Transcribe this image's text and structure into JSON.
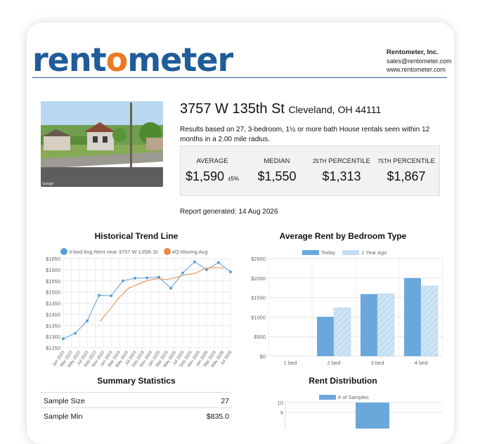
{
  "brand": {
    "logo_pre": "rent",
    "logo_o": "o",
    "logo_post": "meter"
  },
  "company": {
    "name": "Rentometer, Inc.",
    "email": "sales@rentometer.com",
    "website": "www.rentometer.com"
  },
  "property": {
    "street": "3757 W 135th St",
    "city": "Cleveland, OH 44111",
    "description": "Results based on 27, 3-bedroom, 1½ or more bath House rentals seen within 12 months in a 2.00 mile radius."
  },
  "stats": {
    "average_label": "AVERAGE",
    "average_value": "$1,590",
    "average_margin": "±5%",
    "median_label": "MEDIAN",
    "median_value": "$1,550",
    "p25_ord": "25TH",
    "p25_label": "PERCENTILE",
    "p25_value": "$1,313",
    "p75_ord": "75TH",
    "p75_label": "PERCENTILE",
    "p75_value": "$1,867"
  },
  "report_generated": "Report generated: 14 Aug 2026",
  "colors": {
    "primary": "#1f5c98",
    "accent": "#ea7a25",
    "series_blue": "#5aa0d6",
    "series_light": "#b7d6ef"
  },
  "chart_data": [
    {
      "type": "line",
      "title": "Historical Trend Line",
      "x": [
        "Jan 2023",
        "Mar 2023",
        "May 2023",
        "Jul 2023",
        "Sep 2023",
        "Nov 2023",
        "Jan 2024",
        "Mar 2024",
        "May 2024",
        "Jul 2024",
        "Sep 2024",
        "Nov 2024",
        "Jan 2025",
        "Mar 2025",
        "May 2025",
        "Jul 2025",
        "Sep 2025",
        "Nov 2025",
        "Jan 2026",
        "Mar 2026",
        "May 2026",
        "Jul 2026"
      ],
      "series": [
        {
          "name": "3-bed Avg Rent near 3757 W 135th St",
          "values": [
            1290,
            1315,
            1370,
            1485,
            1483,
            1550,
            1562,
            1563,
            1567,
            1517,
            1585,
            1635,
            1600,
            1632,
            1590
          ]
        },
        {
          "name": "4Q Moving Avg",
          "values": [
            1368,
            1420,
            1475,
            1517,
            1535,
            1552,
            1560,
            1556,
            1565,
            1578,
            1583,
            1605,
            1610,
            1608
          ]
        }
      ],
      "ylim": [
        1250,
        1650
      ],
      "yticks": [
        "$1650",
        "$1600",
        "$1550",
        "$1500",
        "$1450",
        "$1400",
        "$1350",
        "$1300",
        "$1250"
      ],
      "grid": true,
      "legend_position": "top"
    },
    {
      "type": "bar",
      "title": "Average Rent by Bedroom Type",
      "categories": [
        "1 bed",
        "2 bed",
        "3 bed",
        "4 bed"
      ],
      "series": [
        {
          "name": "Today",
          "values": [
            0,
            1010,
            1590,
            2000
          ]
        },
        {
          "name": "1 Year Ago",
          "values": [
            0,
            1240,
            1600,
            1800
          ]
        }
      ],
      "ylim": [
        0,
        2500
      ],
      "yticks": [
        "$2500",
        "$2000",
        "$1500",
        "$1000",
        "$500",
        "$0"
      ],
      "grid": true,
      "legend_position": "top"
    },
    {
      "type": "bar",
      "title": "Rent Distribution",
      "series": [
        {
          "name": "# of Samples",
          "values": [
            10
          ]
        }
      ],
      "ylim": [
        0,
        10
      ],
      "yticks": [
        "10",
        "9"
      ],
      "legend_position": "top"
    }
  ],
  "summary": {
    "title": "Summary Statistics",
    "rows": [
      {
        "label": "Sample Size",
        "value": "27"
      },
      {
        "label": "Sample Min",
        "value": "$835.0"
      }
    ]
  }
}
